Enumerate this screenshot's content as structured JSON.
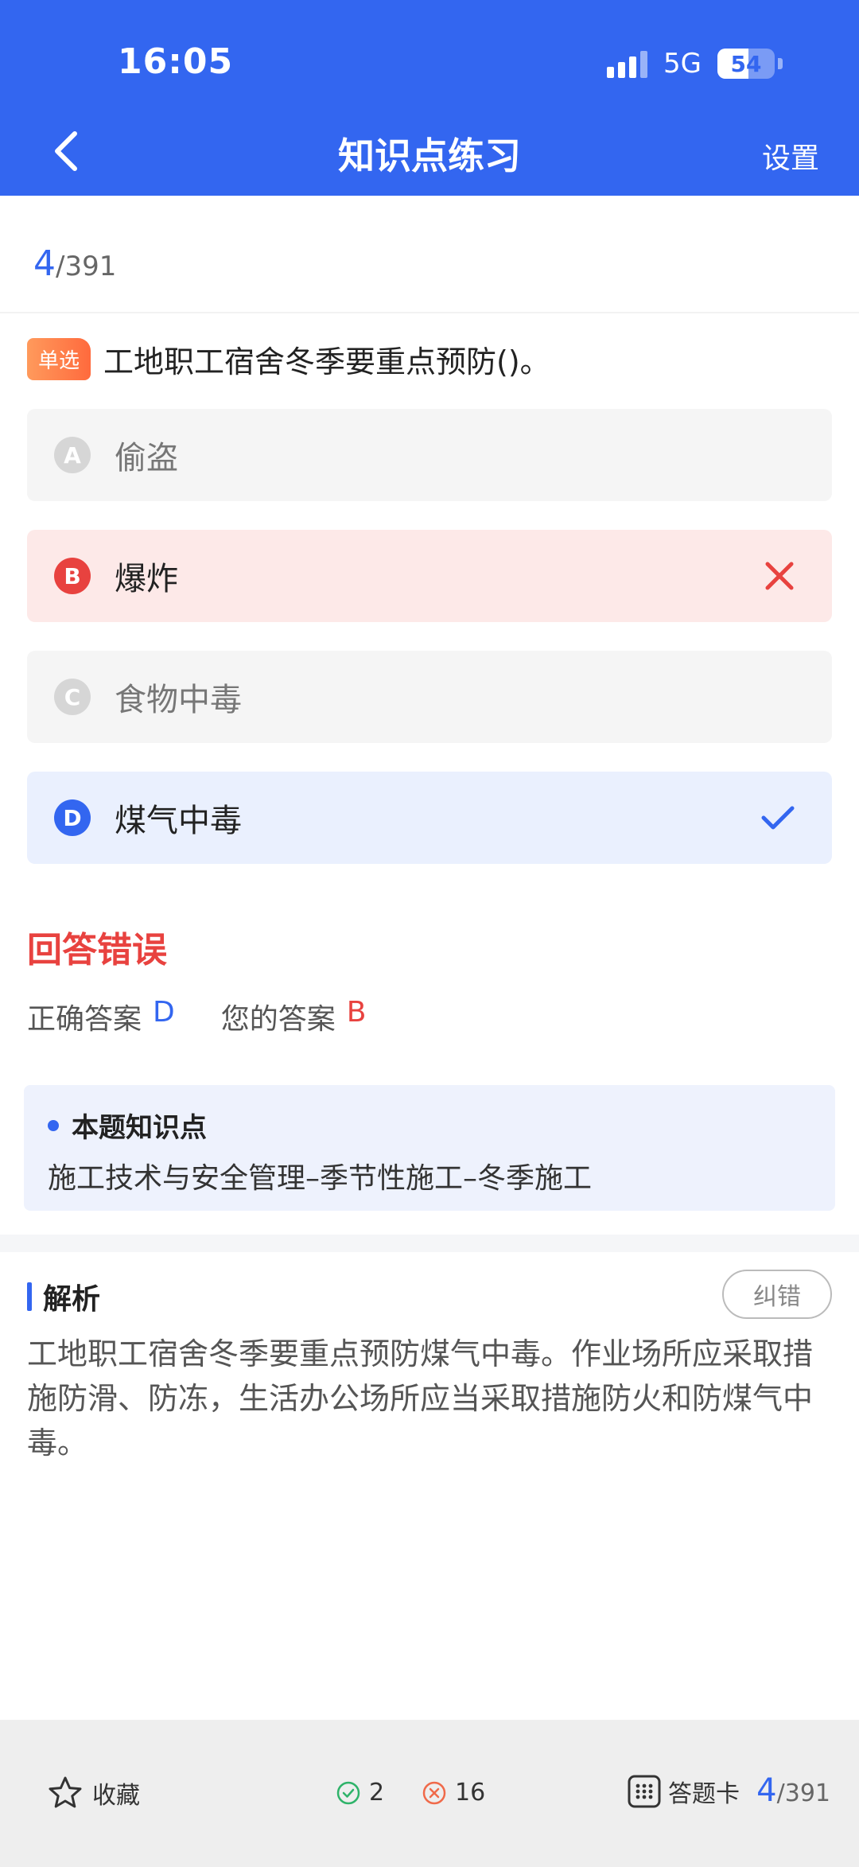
{
  "status_bar": {
    "time": "16:05",
    "network": "5G",
    "battery": "54",
    "battery_level": 0.54
  },
  "header": {
    "title": "知识点练习",
    "settings_label": "设置"
  },
  "progress": {
    "current": "4",
    "total": "/391"
  },
  "question": {
    "type_tag": "单选",
    "text": "工地职工宿舍冬季要重点预防()。",
    "options": [
      {
        "letter": "A",
        "text": "偷盗",
        "state": "neutral"
      },
      {
        "letter": "B",
        "text": "爆炸",
        "state": "wrong"
      },
      {
        "letter": "C",
        "text": "食物中毒",
        "state": "neutral"
      },
      {
        "letter": "D",
        "text": "煤气中毒",
        "state": "correct"
      }
    ]
  },
  "result": {
    "title": "回答错误",
    "correct_label": "正确答案",
    "correct_value": "D",
    "yours_label": "您的答案",
    "yours_value": "B"
  },
  "knowledge_point": {
    "title": "本题知识点",
    "text": "施工技术与安全管理–季节性施工–冬季施工"
  },
  "analysis": {
    "label": "解析",
    "report_button": "纠错",
    "text": "工地职工宿舍冬季要重点预防煤气中毒。作业场所应采取措施防滑、防冻，生活办公场所应当采取措施防火和防煤气中毒。"
  },
  "bottom_bar": {
    "favorite_label": "收藏",
    "right_count": "2",
    "wrong_count": "16",
    "answer_card_label": "答题卡",
    "current": "4",
    "total": "/391"
  },
  "colors": {
    "primary": "#3366f0",
    "error": "#e8423f",
    "tag": "#ff7a45"
  }
}
